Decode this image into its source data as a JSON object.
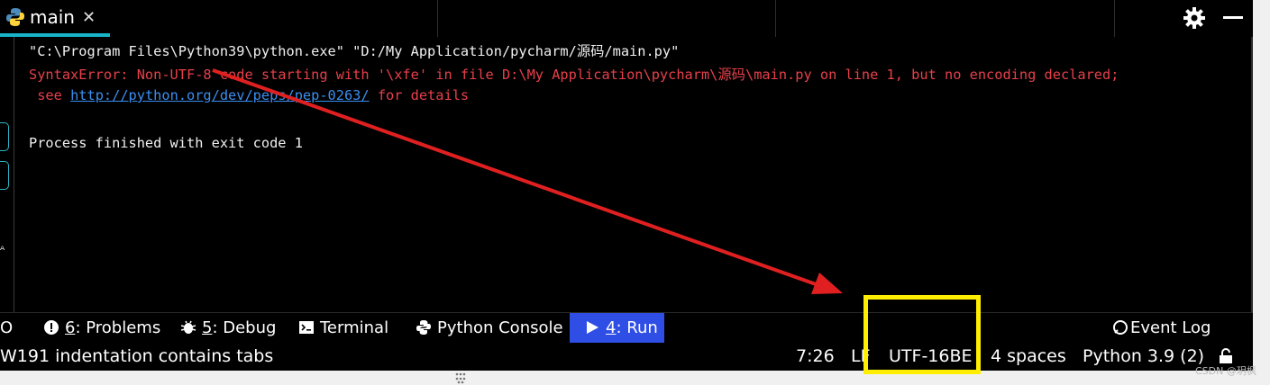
{
  "tab": {
    "title": "main",
    "close": "✕",
    "icon": "python-icon"
  },
  "header_icons": [
    "gear-icon",
    "minimize-icon"
  ],
  "console": {
    "command": "\"C:\\Program Files\\Python39\\python.exe\" \"D:/My Application/pycharm/源码/main.py\"",
    "error_line": "SyntaxError: Non-UTF-8 code starting with '\\xfe' in file D:\\My Application\\pycharm\\源码\\main.py on line 1, but no encoding declared;",
    "see_prefix": " see ",
    "link": "http://python.org/dev/peps/pep-0263/",
    "see_suffix": " for details",
    "exit": "Process finished with exit code 1"
  },
  "tools": {
    "todo_partial": "O",
    "problems_num": "6",
    "problems_label": ": Problems",
    "debug_num": "5",
    "debug_label": ": Debug",
    "terminal": "Terminal",
    "python_console": "Python Console",
    "run_num": "4",
    "run_label": ": Run",
    "event_log": "Event Log"
  },
  "status": {
    "message": "W191 indentation contains tabs",
    "position": "7:26",
    "line_sep": "LF",
    "encoding": "UTF-16BE",
    "indent": "4 spaces",
    "interpreter": "Python 3.9 (2)"
  },
  "watermark": "CSDN @玥枫",
  "colors": {
    "accent_tab": "#18b4c8",
    "run_active": "#2f4ee6",
    "error": "#e8404a",
    "link": "#3a8ff0",
    "highlight": "#ffee00",
    "arrow": "#e02020"
  }
}
